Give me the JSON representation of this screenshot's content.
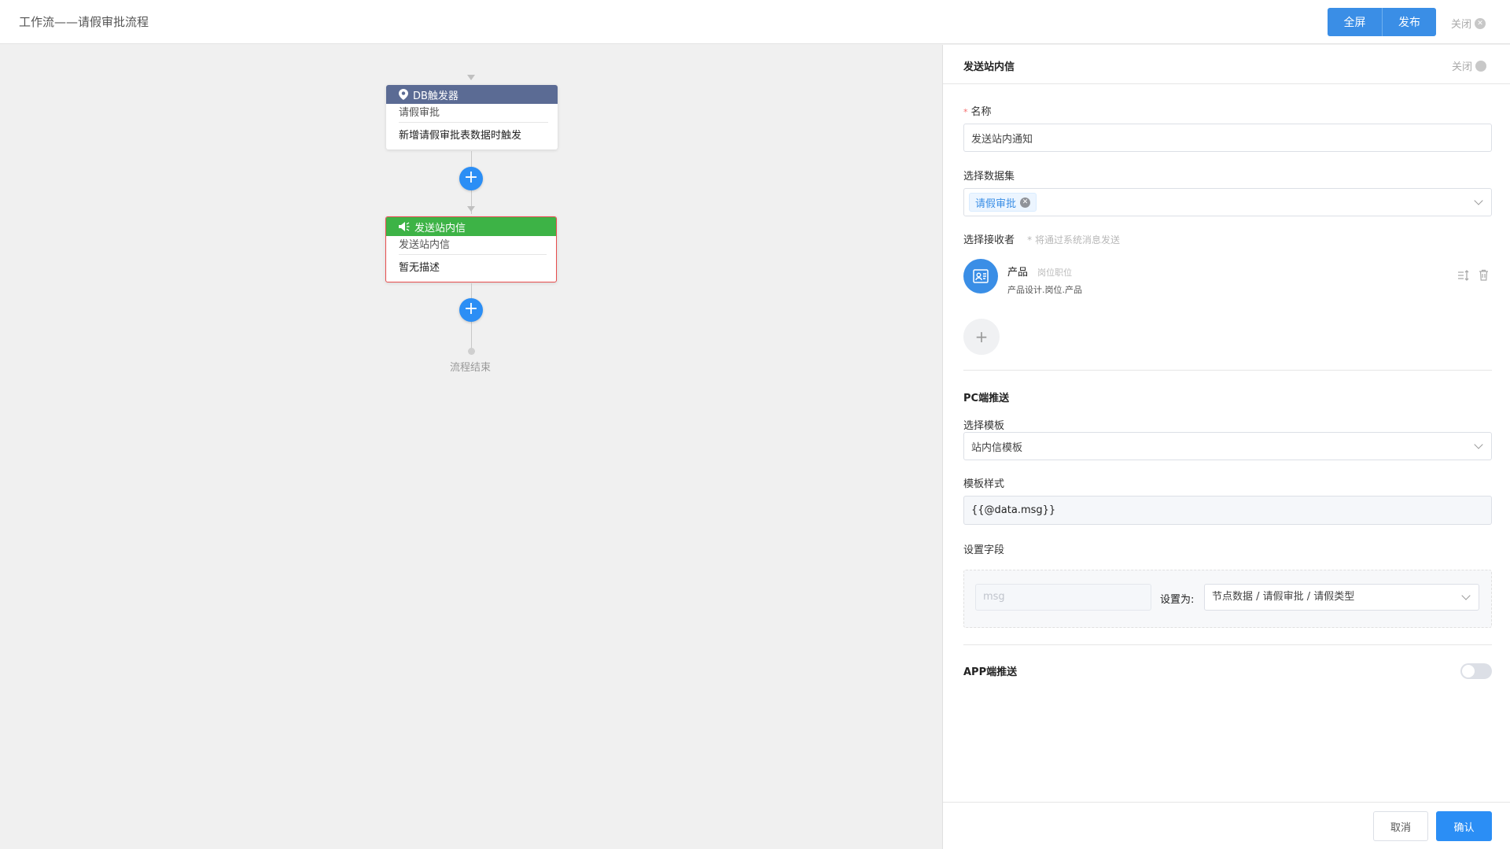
{
  "header": {
    "title": "工作流——请假审批流程",
    "buttons": {
      "fullscreen": "全屏",
      "publish": "发布"
    },
    "close_label": "关闭"
  },
  "flow": {
    "nodes": [
      {
        "type": "DB触发器",
        "subtitle": "请假审批",
        "description": "新增请假审批表数据时触发",
        "icon": "location-pin-icon",
        "color": "#5b6b94"
      },
      {
        "type": "发送站内信",
        "subtitle": "发送站内信",
        "description": "暂无描述",
        "icon": "megaphone-icon",
        "color": "#3db346"
      }
    ],
    "end_label": "流程结束"
  },
  "panel": {
    "title": "发送站内信",
    "close_label": "关闭",
    "name": {
      "label": "名称",
      "value": "发送站内通知"
    },
    "dataset": {
      "label": "选择数据集",
      "tag": "请假审批"
    },
    "receiver": {
      "label": "选择接收者",
      "hint": "* 将通过系统消息发送",
      "item": {
        "name": "产品",
        "type": "岗位职位",
        "detail": "产品设计.岗位.产品"
      },
      "add_label": "+"
    },
    "pc_push": {
      "section": "PC端推送",
      "template_label": "选择模板",
      "template_value": "站内信模板",
      "style_label": "模板样式",
      "style_value": "{{@data.msg}}",
      "fields_label": "设置字段",
      "field": {
        "placeholder": "msg",
        "set_as_label": "设置为:",
        "value": "节点数据 / 请假审批 / 请假类型"
      }
    },
    "app_push": {
      "section": "APP端推送",
      "enabled": false
    },
    "footer": {
      "cancel": "取消",
      "confirm": "确认"
    }
  }
}
